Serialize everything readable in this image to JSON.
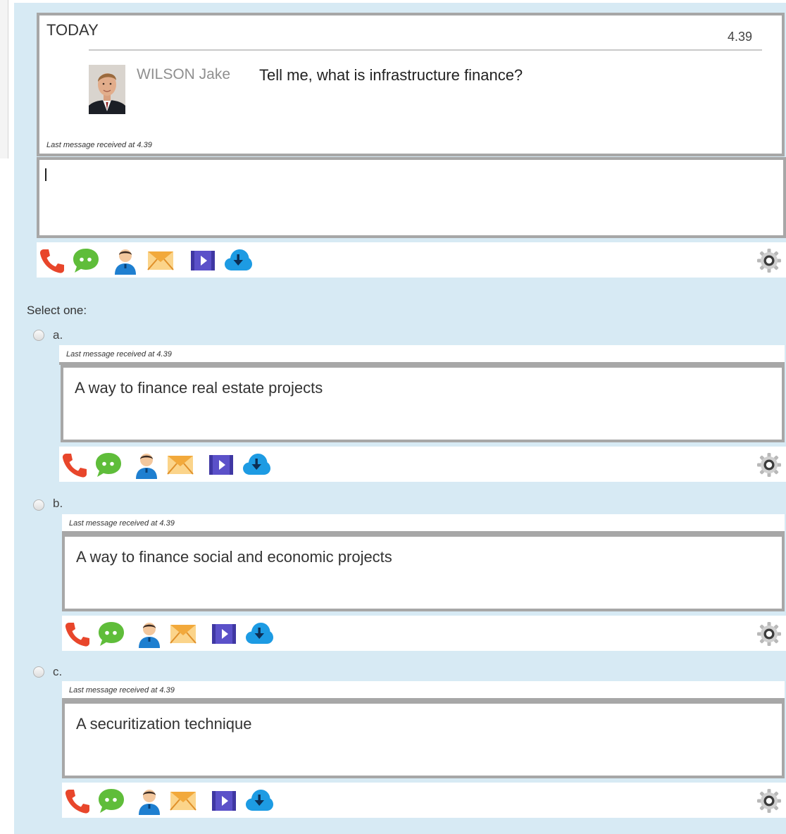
{
  "chat": {
    "day_label": "TODAY",
    "time": "4.39",
    "sender": "WILSON Jake",
    "message": "Tell me, what is infrastructure finance?",
    "last_message": "Last message received at 4.39"
  },
  "question": {
    "prompt": "Select one:",
    "options": [
      {
        "letter": "a.",
        "last_message": "Last message received at 4.39",
        "text": "A way to finance real estate projects"
      },
      {
        "letter": "b.",
        "last_message": "Last message received at 4.39",
        "text": "A way to finance social and economic projects"
      },
      {
        "letter": "c.",
        "last_message": "Last message received at 4.39",
        "text": "A securitization technique"
      }
    ]
  },
  "toolbar_icons": [
    "phone-icon",
    "chat-bubble-icon",
    "user-icon",
    "mail-icon",
    "video-icon",
    "cloud-download-icon",
    "gear-icon"
  ],
  "colors": {
    "panel_bg": "#d7eaf4",
    "border": "#a7a7a7",
    "phone": "#e8462b",
    "chat": "#5fbd3a",
    "user": "#1e7fd0",
    "mail": "#f2a93b",
    "video": "#5b51c9",
    "cloud": "#1d9be3"
  }
}
